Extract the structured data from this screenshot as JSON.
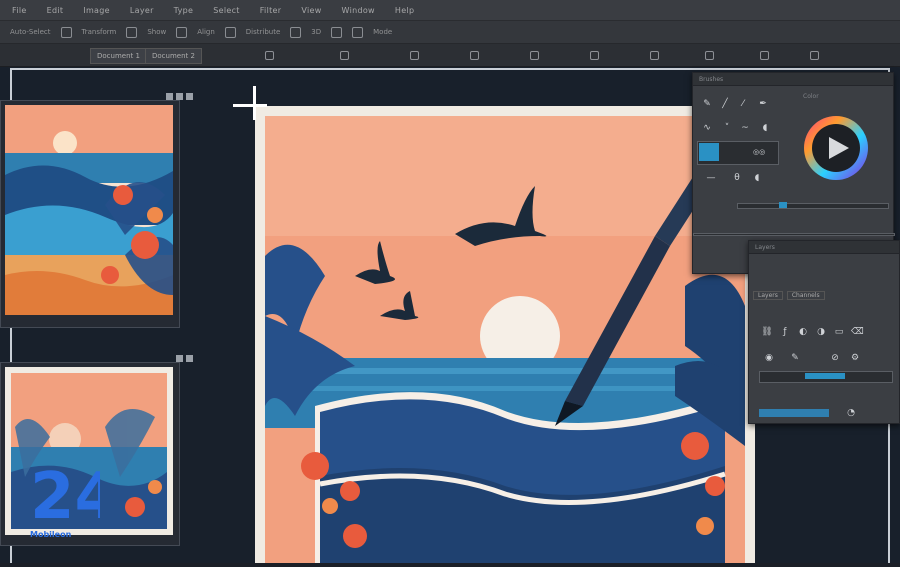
{
  "menubar": {
    "items": [
      "File",
      "Edit",
      "Image",
      "Layer",
      "Type",
      "Select",
      "Filter",
      "View",
      "Window",
      "Help"
    ]
  },
  "options_bar": {
    "items": [
      "Auto-Select",
      "Transform",
      "Show",
      "Align",
      "Distribute",
      "3D",
      "Mode"
    ]
  },
  "tabs": [
    "Document 1",
    "Document 2"
  ],
  "panels": {
    "brush_panel": {
      "title": "Brushes"
    },
    "color_panel": {
      "title": "Color"
    },
    "layers_panel": {
      "title": "Layers",
      "tabs": [
        "Layers",
        "Channels"
      ]
    }
  },
  "logo": {
    "number": "24",
    "text": "Mobileon"
  },
  "colors": {
    "sky": "#f2a07f",
    "sea": "#2f7fb0",
    "accent_blue": "#2a91c4",
    "wave": "#26508a",
    "flower": "#e85b3d"
  }
}
